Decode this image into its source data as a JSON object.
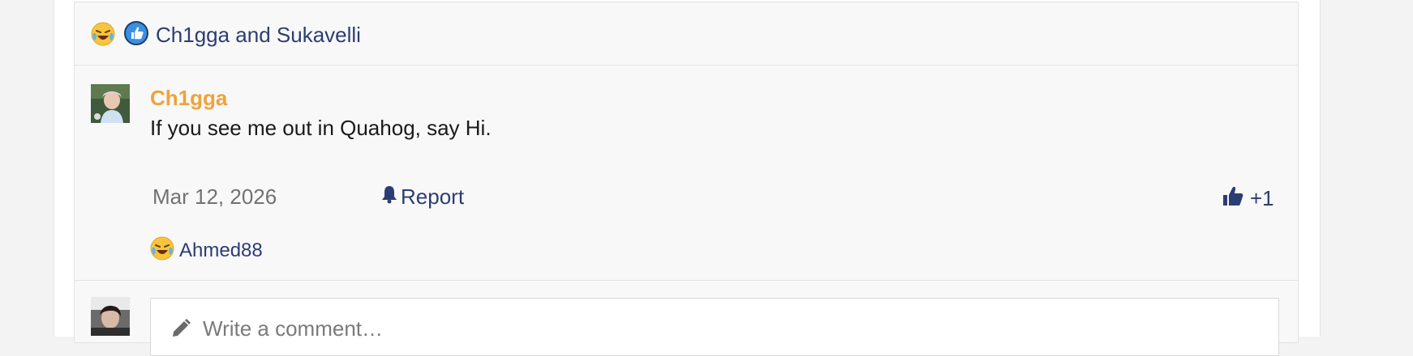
{
  "reactions_summary": {
    "emoji_icon": "laughing-crying-emoji-icon",
    "like_icon": "thumbs-up-circle-icon",
    "names": "Ch1gga and Sukavelli"
  },
  "comment": {
    "author": "Ch1gga",
    "text": "If you see me out in Quahog, say Hi.",
    "date": "Mar 12, 2026",
    "report_label": "Report",
    "like_label": "+1",
    "reaction": {
      "emoji_icon": "laughing-crying-emoji-icon",
      "names": "Ahmed88"
    }
  },
  "composer": {
    "placeholder": "Write a comment…"
  },
  "colors": {
    "link": "#2c3d73",
    "author": "#f0a23b",
    "like_blue": "#3b8fe0"
  }
}
